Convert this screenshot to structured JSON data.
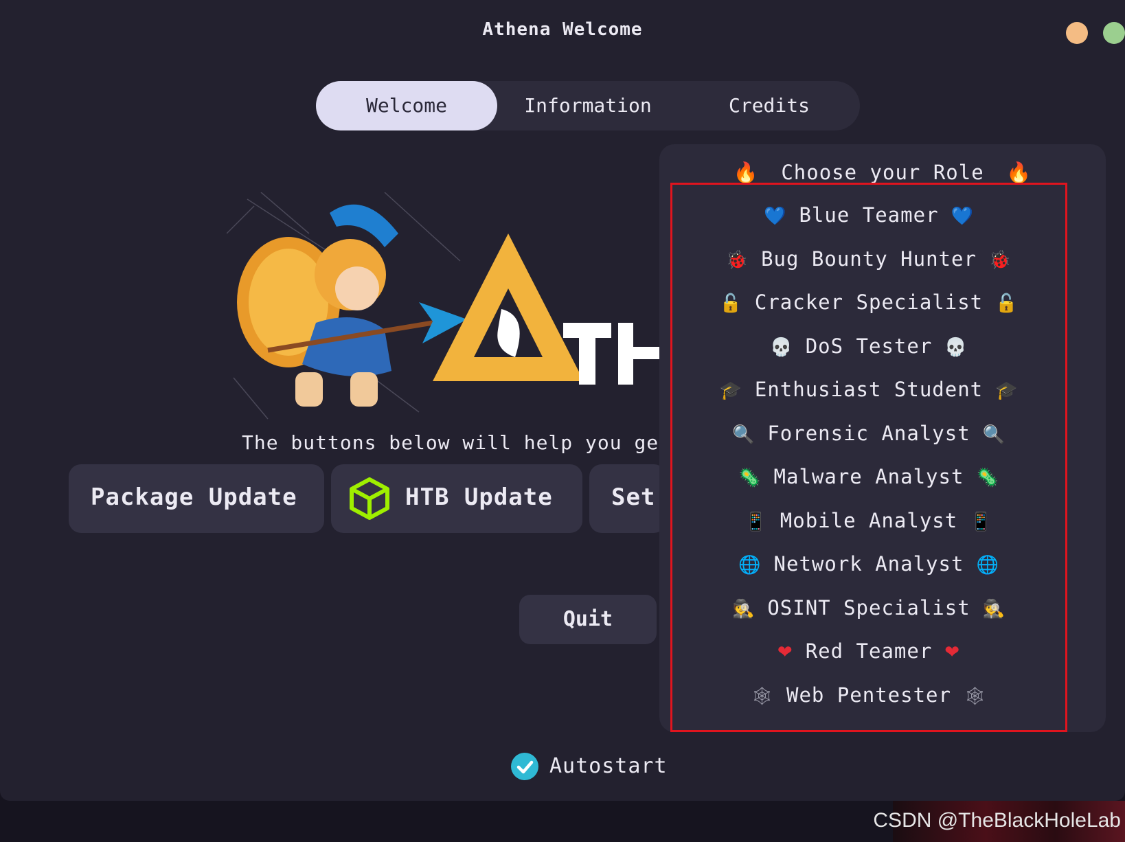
{
  "window": {
    "title": "Athena Welcome"
  },
  "tabs": [
    {
      "label": "Welcome",
      "active": true
    },
    {
      "label": "Information",
      "active": false
    },
    {
      "label": "Credits",
      "active": false
    }
  ],
  "main": {
    "subtitle": "The buttons below will help you ge",
    "buttons": {
      "package_update": "Package Update",
      "htb_update": "HTB Update",
      "setup_partial": "Set"
    },
    "quit_label": "Quit",
    "autostart": {
      "label": "Autostart",
      "checked": true
    }
  },
  "roles": {
    "title": "Choose your Role",
    "title_icon": "fire-icon",
    "items": [
      {
        "label": "Blue Teamer",
        "icon": "blue-heart-icon",
        "glyph": "💙"
      },
      {
        "label": "Bug Bounty Hunter",
        "icon": "ladybug-icon",
        "glyph": "🐞"
      },
      {
        "label": "Cracker Specialist",
        "icon": "cracker-icon",
        "glyph": "🔓"
      },
      {
        "label": "DoS Tester",
        "icon": "skull-icon",
        "glyph": "💀"
      },
      {
        "label": "Enthusiast Student",
        "icon": "graduation-cap-icon",
        "glyph": "🎓"
      },
      {
        "label": "Forensic Analyst",
        "icon": "magnifier-icon",
        "glyph": "🔍"
      },
      {
        "label": "Malware Analyst",
        "icon": "microbe-icon",
        "glyph": "🦠"
      },
      {
        "label": "Mobile Analyst",
        "icon": "mobile-phone-icon",
        "glyph": "📱"
      },
      {
        "label": "Network Analyst",
        "icon": "globe-icon",
        "glyph": "🌐"
      },
      {
        "label": "OSINT Specialist",
        "icon": "detective-icon",
        "glyph": "🕵"
      },
      {
        "label": "Red Teamer",
        "icon": "red-heart-icon",
        "glyph": "❤"
      },
      {
        "label": "Web Pentester",
        "icon": "spider-web-icon",
        "glyph": "🕸"
      }
    ]
  },
  "watermark": "CSDN @TheBlackHoleLab",
  "colors": {
    "window_bg": "#23212f",
    "panel_bg": "#2c2a3a",
    "active_tab": "#dedcf2",
    "highlight_border": "#e0141e",
    "checkbox": "#2fb9d4",
    "logo_yellow": "#f2b33d",
    "htb_green": "#9fef00"
  }
}
